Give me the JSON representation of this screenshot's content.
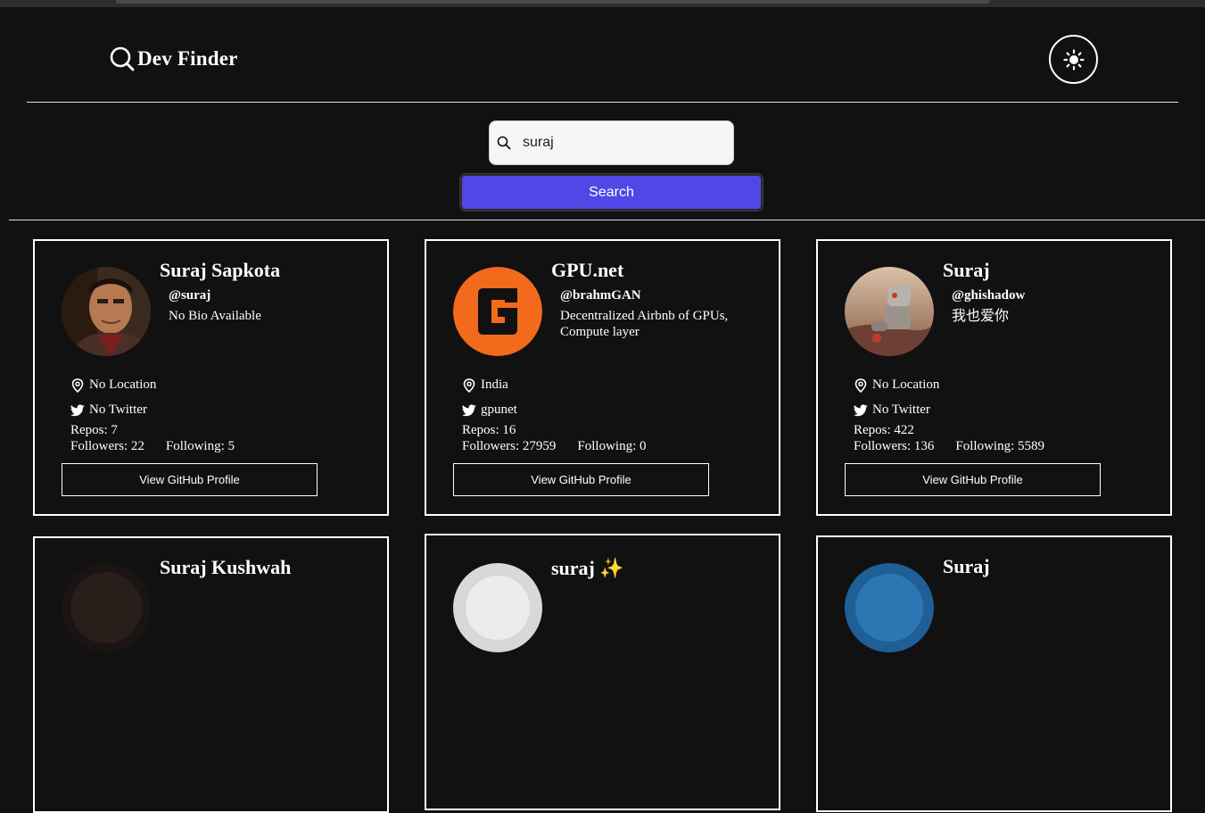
{
  "app": {
    "title": "Dev Finder",
    "theme_toggle_icon": "sun-icon"
  },
  "search": {
    "value": "suraj",
    "button_label": "Search"
  },
  "profile_button_label": "View GitHub Profile",
  "cards": [
    {
      "name": "Suraj Sapkota",
      "login": "@suraj",
      "bio": "No Bio Available",
      "location": "No Location",
      "twitter": "No Twitter",
      "repos": "Repos: 7",
      "followers": "Followers: 22",
      "following": "Following: 5"
    },
    {
      "name": "GPU.net",
      "login": "@brahmGAN",
      "bio": "Decentralized Airbnb of GPUs, Compute layer",
      "location": "India",
      "twitter": "gpunet",
      "repos": "Repos: 16",
      "followers": "Followers: 27959",
      "following": "Following: 0"
    },
    {
      "name": "Suraj",
      "login": "@ghishadow",
      "bio": "我也爱你",
      "location": "No Location",
      "twitter": "No Twitter",
      "repos": "Repos: 422",
      "followers": "Followers: 136",
      "following": "Following: 5589"
    },
    {
      "name": "Suraj Kushwah"
    },
    {
      "name": "suraj ✨"
    },
    {
      "name": "Suraj"
    }
  ]
}
